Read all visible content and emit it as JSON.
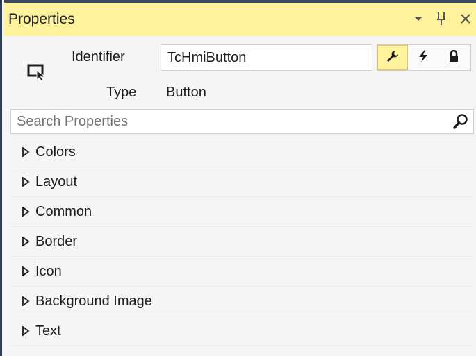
{
  "window": {
    "title": "Properties",
    "controls": [
      {
        "name": "window-position-dropdown",
        "icon": "chevron-down-icon",
        "glyph": "▾"
      },
      {
        "name": "pin-button",
        "icon": "pin-icon",
        "glyph": "Ⅱ"
      },
      {
        "name": "close-button",
        "icon": "close-icon",
        "glyph": "✕"
      }
    ]
  },
  "header": {
    "identifier_label": "Identifier",
    "identifier_value": "TcHmiButton",
    "type_label": "Type",
    "type_value": "Button",
    "tools": [
      {
        "name": "properties-view-button",
        "icon": "wrench-icon",
        "active": true
      },
      {
        "name": "events-view-button",
        "icon": "lightning-icon",
        "active": false
      },
      {
        "name": "permissions-view-button",
        "icon": "lock-icon",
        "active": false
      }
    ]
  },
  "search": {
    "placeholder": "Search Properties",
    "value": ""
  },
  "categories": [
    {
      "label": "Colors"
    },
    {
      "label": "Layout"
    },
    {
      "label": "Common"
    },
    {
      "label": "Border"
    },
    {
      "label": "Icon"
    },
    {
      "label": "Background Image"
    },
    {
      "label": "Text"
    }
  ],
  "colors": {
    "accent_yellow": "#fff29d",
    "frame_dark": "#2b3a55",
    "background": "#f5f5f5"
  }
}
